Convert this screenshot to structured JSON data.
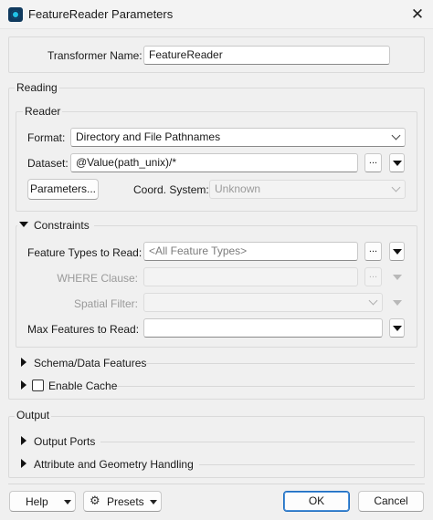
{
  "window": {
    "title": "FeatureReader Parameters",
    "close_glyph": "✕"
  },
  "transformer": {
    "label": "Transformer Name:",
    "value": "FeatureReader"
  },
  "reading": {
    "label": "Reading",
    "reader": {
      "label": "Reader",
      "format": {
        "label": "Format:",
        "value": "Directory and File Pathnames"
      },
      "dataset": {
        "label": "Dataset:",
        "value": "@Value(path_unix)/*"
      },
      "parameters_button": "Parameters...",
      "coord_system": {
        "label": "Coord. System:",
        "value": "Unknown"
      }
    },
    "constraints": {
      "label": "Constraints",
      "feature_types": {
        "label": "Feature Types to Read:",
        "placeholder": "<All Feature Types>"
      },
      "where_clause": {
        "label": "WHERE Clause:",
        "value": ""
      },
      "spatial_filter": {
        "label": "Spatial Filter:",
        "value": ""
      },
      "max_features": {
        "label": "Max Features to Read:",
        "value": ""
      }
    },
    "schema_label": "Schema/Data Features",
    "cache_label": "Enable Cache"
  },
  "output": {
    "label": "Output",
    "output_ports_label": "Output Ports",
    "attr_geom_label": "Attribute and Geometry Handling"
  },
  "footer": {
    "help": "Help",
    "presets": "Presets",
    "ok": "OK",
    "cancel": "Cancel"
  },
  "ellipsis": "...",
  "colors": {
    "accent": "#1e6dbf",
    "app_icon": "#21c3e6"
  }
}
